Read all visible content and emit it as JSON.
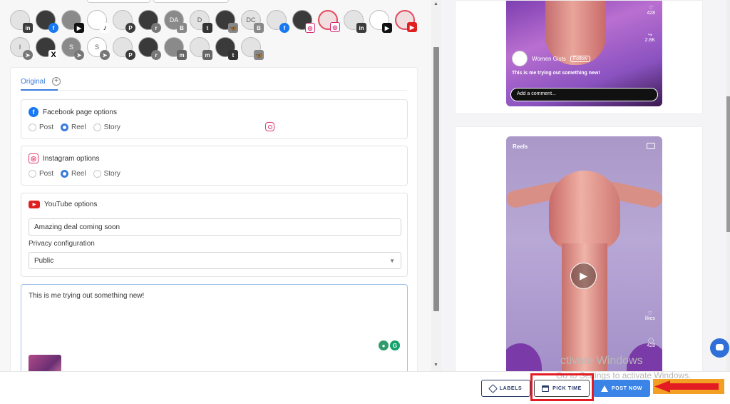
{
  "composer": {
    "tab_original": "Original",
    "add_tab_icon": "plus-circle-icon",
    "avatars_row1": [
      {
        "initials": "",
        "network": "linkedin",
        "badge": "in"
      },
      {
        "initials": "",
        "network": "facebook",
        "badge": "f"
      },
      {
        "initials": "",
        "network": "youtube",
        "badge": "▶"
      },
      {
        "initials": "",
        "network": "tiktok",
        "badge": "♪"
      },
      {
        "initials": "",
        "network": "pinterest",
        "badge": "P"
      },
      {
        "initials": "",
        "network": "reddit",
        "badge": "r"
      },
      {
        "initials": "DA",
        "network": "blogger",
        "badge": "B"
      },
      {
        "initials": "D",
        "network": "tumblr",
        "badge": "t"
      },
      {
        "initials": "",
        "network": "bluesky",
        "badge": "🦋"
      },
      {
        "initials": "DC",
        "network": "blogger",
        "badge": "B"
      },
      {
        "initials": "",
        "network": "facebook",
        "badge": "f"
      },
      {
        "initials": "",
        "network": "instagram",
        "badge": "◎"
      },
      {
        "initials": "",
        "network": "instagram",
        "badge": "◎"
      },
      {
        "initials": "",
        "network": "linkedin",
        "badge": "in"
      },
      {
        "initials": "",
        "network": "youtube",
        "badge": "▶"
      },
      {
        "initials": "",
        "network": "youtube",
        "badge": "▶"
      }
    ],
    "avatars_row2": [
      {
        "initials": "I",
        "network": "telegram",
        "badge": "➤"
      },
      {
        "initials": "",
        "network": "x",
        "badge": "X"
      },
      {
        "initials": "S",
        "network": "telegram",
        "badge": "➤"
      },
      {
        "initials": "S",
        "network": "telegram",
        "badge": "➤"
      },
      {
        "initials": "",
        "network": "pinterest",
        "badge": "P"
      },
      {
        "initials": "",
        "network": "reddit",
        "badge": "r"
      },
      {
        "initials": "",
        "network": "mastodon",
        "badge": "m"
      },
      {
        "initials": "",
        "network": "mastodon",
        "badge": "m"
      },
      {
        "initials": "",
        "network": "tumblr",
        "badge": "t"
      },
      {
        "initials": "",
        "network": "bluesky",
        "badge": "🦋"
      }
    ],
    "facebook": {
      "title": "Facebook page options",
      "options": [
        "Post",
        "Reel",
        "Story"
      ],
      "selected": "Reel"
    },
    "instagram": {
      "title": "Instagram options",
      "options": [
        "Post",
        "Reel",
        "Story"
      ],
      "selected": "Reel"
    },
    "youtube": {
      "title": "YouTube options",
      "video_title_value": "Amazing deal coming soon",
      "privacy_label": "Privacy configuration",
      "privacy_value": "Public"
    },
    "post_text": "This is me trying out something new!"
  },
  "preview": {
    "account_name": "Women Gists",
    "follow_label": "Follow",
    "caption": "This is me trying out something new!",
    "comment_placeholder": "Add a comment...",
    "count_likes_top": "428",
    "count_shares_top": "2.8K",
    "reels_label": "Reels",
    "likes_label": "likes",
    "count_comments": "428"
  },
  "toolbar": {
    "labels_button": "LABELS",
    "pick_time_button": "PICK TIME",
    "post_now_button": "POST NOW"
  },
  "os_overlay": {
    "activate_windows_partial": "ctivate Windows",
    "go_to_settings": "Go to Settings to activate Windows."
  },
  "colors": {
    "accent": "#3b7bdc",
    "post_now_bg": "#3a84e8",
    "highlight_red": "#e31b23",
    "arrow_orange": "#f2a024",
    "instagram": "#e03a6c",
    "youtube": "#e02020",
    "facebook": "#1877f2"
  }
}
